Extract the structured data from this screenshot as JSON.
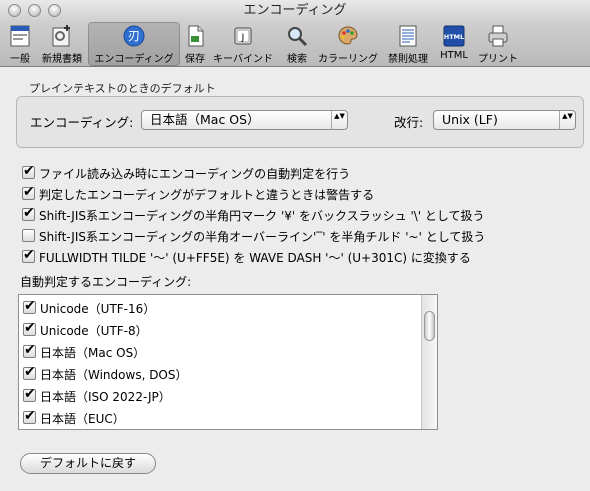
{
  "window": {
    "title": "エンコーディング"
  },
  "toolbar": {
    "items": [
      {
        "label": "一般",
        "icon": "general-icon"
      },
      {
        "label": "新規書類",
        "icon": "new-document-icon"
      },
      {
        "label": "エンコーディング",
        "icon": "encoding-icon",
        "selected": true
      },
      {
        "label": "保存",
        "icon": "save-icon"
      },
      {
        "label": "キーバインド",
        "icon": "keybinding-icon"
      },
      {
        "label": "検索",
        "icon": "search-icon"
      },
      {
        "label": "カラーリング",
        "icon": "coloring-icon"
      },
      {
        "label": "禁則処理",
        "icon": "line-break-icon"
      },
      {
        "label": "HTML",
        "icon": "html-icon"
      },
      {
        "label": "プリント",
        "icon": "print-icon"
      }
    ]
  },
  "plain_text": {
    "group_label": "プレインテキストのときのデフォルト",
    "encoding_label": "エンコーディング:",
    "encoding_value": "日本語（Mac OS）",
    "linebreak_label": "改行:",
    "linebreak_value": "Unix (LF)"
  },
  "options": [
    {
      "label": "ファイル読み込み時にエンコーディングの自動判定を行う",
      "checked": true
    },
    {
      "label": "判定したエンコーディングがデフォルトと違うときは警告する",
      "checked": true
    },
    {
      "label": "Shift-JIS系エンコーディングの半角円マーク '¥' をバックスラッシュ '\\' として扱う",
      "checked": true
    },
    {
      "label": "Shift-JIS系エンコーディングの半角オーバーライン'‾' を半角チルド '~' として扱う",
      "checked": false
    },
    {
      "label": "FULLWIDTH TILDE '～' (U+FF5E) を WAVE DASH '〜' (U+301C) に変換する",
      "checked": true
    }
  ],
  "auto_detect": {
    "label": "自動判定するエンコーディング:",
    "items": [
      {
        "label": "Unicode（UTF-16）",
        "checked": true
      },
      {
        "label": "Unicode（UTF-8）",
        "checked": true
      },
      {
        "label": "日本語（Mac OS）",
        "checked": true
      },
      {
        "label": "日本語（Windows, DOS）",
        "checked": true
      },
      {
        "label": "日本語（ISO 2022-JP）",
        "checked": true
      },
      {
        "label": "日本語（EUC）",
        "checked": true
      }
    ]
  },
  "reset_button": "デフォルトに戻す",
  "check_mark": "✔",
  "popup_arrows": "▲▼"
}
